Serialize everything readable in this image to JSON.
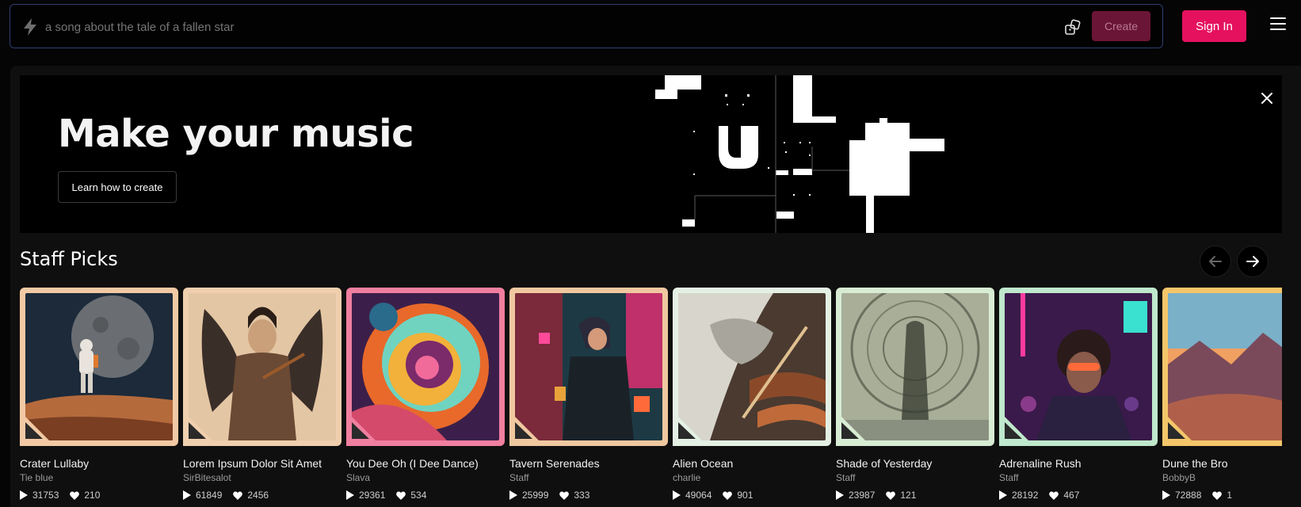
{
  "prompt": {
    "placeholder": "a song about the tale of a fallen star",
    "create_label": "Create"
  },
  "header": {
    "signin_label": "Sign In"
  },
  "banner": {
    "title": "Make your music",
    "learn_label": "Learn how to create"
  },
  "section": {
    "title": "Staff Picks"
  },
  "cards": [
    {
      "title": "Crater Lullaby",
      "author": "Tie blue",
      "plays": "31753",
      "likes": "210"
    },
    {
      "title": "Lorem Ipsum Dolor Sit Amet",
      "author": "SirBitesalot",
      "plays": "61849",
      "likes": "2456"
    },
    {
      "title": "You Dee Oh (I Dee Dance)",
      "author": "Slava",
      "plays": "29361",
      "likes": "534"
    },
    {
      "title": "Tavern Serenades",
      "author": "Staff",
      "plays": "25999",
      "likes": "333"
    },
    {
      "title": "Alien Ocean",
      "author": "charlie",
      "plays": "49064",
      "likes": "901"
    },
    {
      "title": "Shade of Yesterday",
      "author": "Staff",
      "plays": "23987",
      "likes": "121"
    },
    {
      "title": "Adrenaline Rush",
      "author": "Staff",
      "plays": "28192",
      "likes": "467"
    },
    {
      "title": "Dune the Bro",
      "author": "BobbyB",
      "plays": "72888",
      "likes": "1"
    }
  ],
  "colors": {
    "accent": "#e5115e",
    "create_disabled": "#6b1536"
  },
  "icons": [
    "bolt-icon",
    "dice-icon",
    "menu-icon",
    "close-icon",
    "arrow-left-icon",
    "arrow-right-icon",
    "play-icon",
    "heart-icon"
  ]
}
